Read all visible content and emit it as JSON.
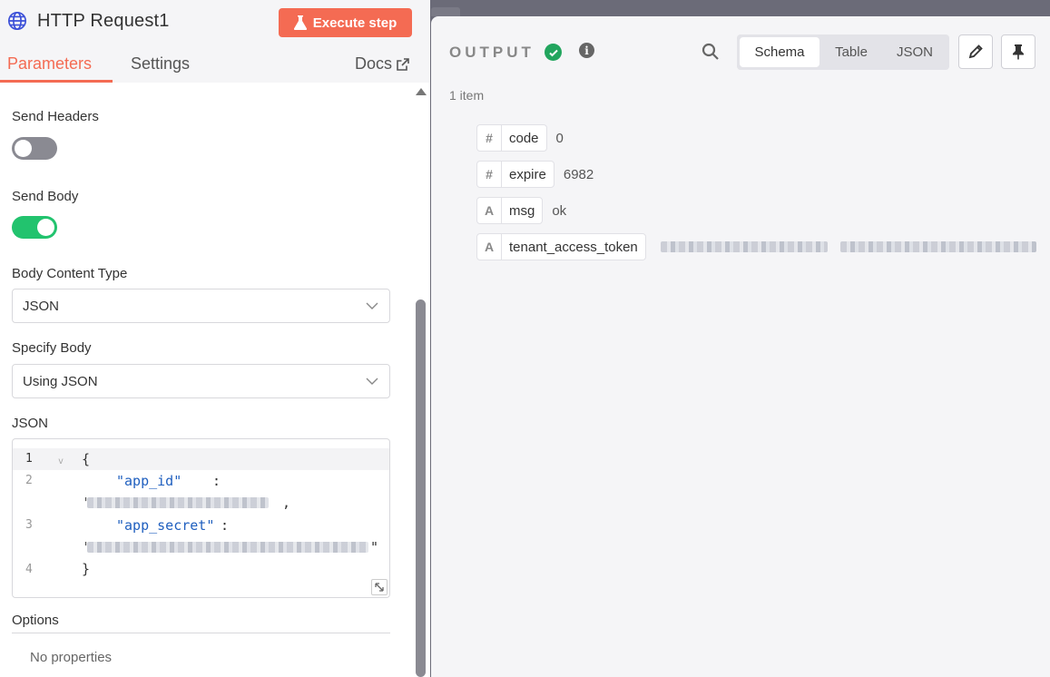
{
  "node": {
    "title": "HTTP Request1",
    "execute_label": "Execute step"
  },
  "tabs": {
    "parameters": "Parameters",
    "settings": "Settings",
    "docs": "Docs"
  },
  "params": {
    "send_headers_label": "Send Headers",
    "send_headers_on": false,
    "send_body_label": "Send Body",
    "send_body_on": true,
    "body_content_type_label": "Body Content Type",
    "body_content_type_value": "JSON",
    "specify_body_label": "Specify Body",
    "specify_body_value": "Using JSON",
    "json_label": "JSON",
    "json_editor": {
      "line_numbers": [
        "1",
        "2",
        "3",
        "4"
      ],
      "open_brace": "{",
      "close_brace": "}",
      "key_app_id": "\"app_id\"",
      "key_app_secret": "\"app_secret\"",
      "colon": ":",
      "quote_open": "'",
      "comma": ",",
      "quote_close": "\""
    },
    "options_label": "Options",
    "no_properties": "No properties"
  },
  "output": {
    "title": "OUTPUT",
    "views": [
      "Schema",
      "Table",
      "JSON"
    ],
    "active_view": "Schema",
    "item_count": "1 item",
    "fields": [
      {
        "type_icon": "#",
        "name": "code",
        "value": "0"
      },
      {
        "type_icon": "#",
        "name": "expire",
        "value": "6982"
      },
      {
        "type_icon": "A",
        "name": "msg",
        "value": "ok"
      },
      {
        "type_icon": "A",
        "name": "tenant_access_token",
        "value": ""
      }
    ]
  },
  "colors": {
    "accent": "#f46b53",
    "success": "#22a55e",
    "toggle_on": "#22c36e"
  }
}
